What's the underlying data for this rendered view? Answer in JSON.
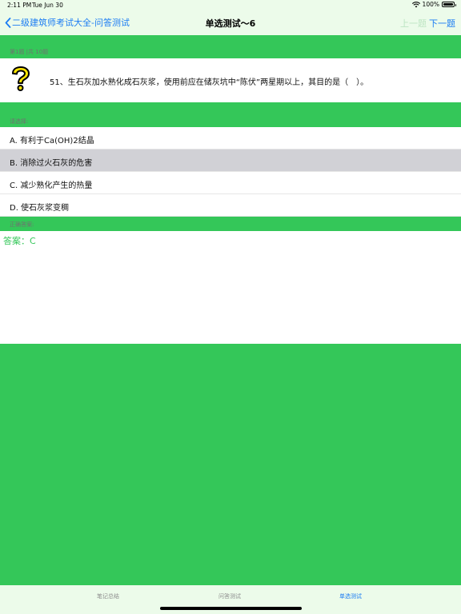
{
  "status": {
    "time": "2:11 PM",
    "date": "Tue Jun 30",
    "battery": "100%"
  },
  "nav": {
    "back_label": "二级建筑师考试大全-问答测试",
    "title": "单选测试～6",
    "prev_label": "上一题",
    "next_label": "下一题"
  },
  "question": {
    "counter": "第1题 |共 10题",
    "text": "51、生石灰加水熟化成石灰浆，使用前应在储灰坑中“陈伏”两星期以上，其目的是（　）。",
    "icon": "question-mark-icon"
  },
  "choose_label": "请选择:",
  "options": [
    {
      "label": "A.  有利于Ca(OH)2结晶",
      "selected": false
    },
    {
      "label": "B.  消除过火石灰的危害",
      "selected": true
    },
    {
      "label": "C.  减少熟化产生的热量",
      "selected": false
    },
    {
      "label": "D.  使石灰浆变稠",
      "selected": false
    }
  ],
  "answer": {
    "section_label": "正确答案:",
    "text": "答案：C"
  },
  "tabs": [
    {
      "label": "笔记总结",
      "active": false
    },
    {
      "label": "问答测试",
      "active": false
    },
    {
      "label": "单选测试",
      "active": true
    }
  ],
  "colors": {
    "accent": "#1B7CF3",
    "green": "#34C759",
    "bar_bg": "#ECFBEA",
    "selected": "#D1D1D6"
  }
}
